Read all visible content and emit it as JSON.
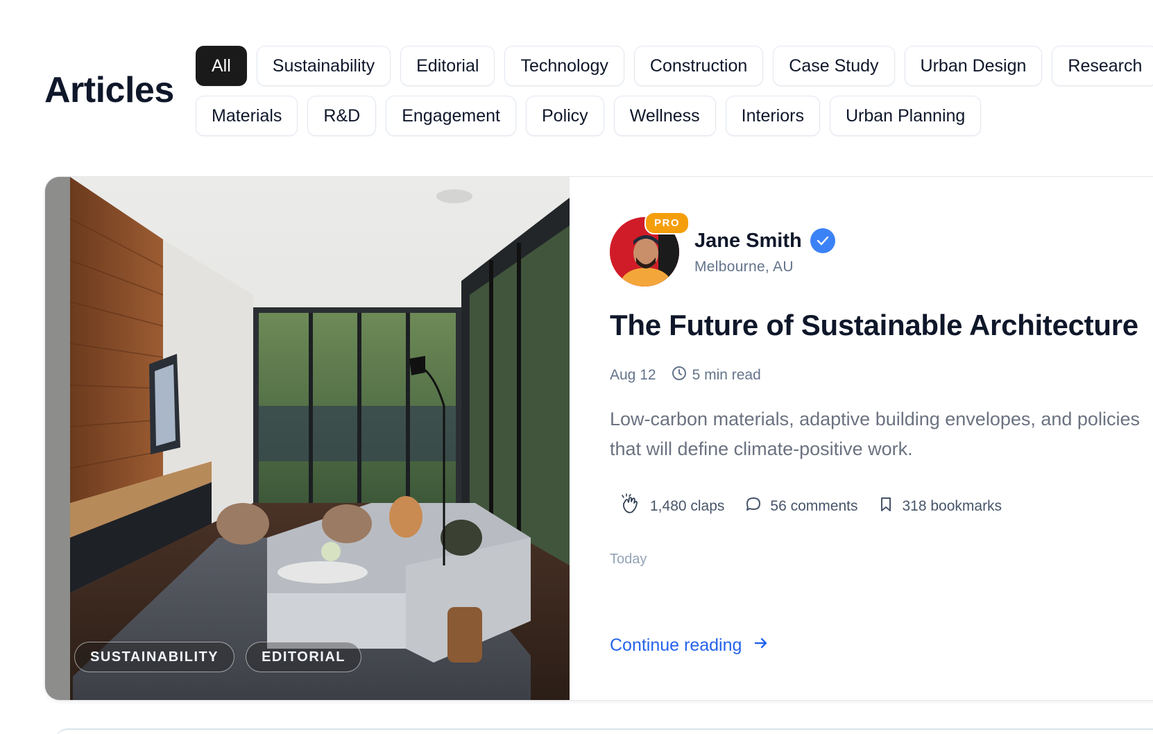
{
  "header": {
    "title": "Articles"
  },
  "filters": {
    "row1": [
      "All",
      "Sustainability",
      "Editorial",
      "Technology",
      "Construction",
      "Case Study",
      "Urban Design",
      "Research"
    ],
    "row2": [
      "Materials",
      "R&D",
      "Engagement",
      "Policy",
      "Wellness",
      "Interiors",
      "Urban Planning"
    ],
    "active": "All"
  },
  "article": {
    "tags": [
      "SUSTAINABILITY",
      "EDITORIAL"
    ],
    "author": {
      "name": "Jane Smith",
      "location": "Melbourne, AU",
      "badge": "PRO",
      "verified_icon": "check-icon"
    },
    "title": "The Future of Sustainable Architecture",
    "date": "Aug 12",
    "read_time": "5 min read",
    "excerpt": "Low-carbon materials, adaptive building envelopes, and policies that will define climate-positive work.",
    "stats": {
      "claps": "1,480 claps",
      "comments": "56 comments",
      "bookmarks": "318 bookmarks"
    },
    "posted": "Today",
    "cta": "Continue reading"
  },
  "colors": {
    "accent": "#2563eb",
    "active_chip": "#1a1a1a",
    "pro_badge": "#f59e0b",
    "verified": "#3b82f6"
  }
}
